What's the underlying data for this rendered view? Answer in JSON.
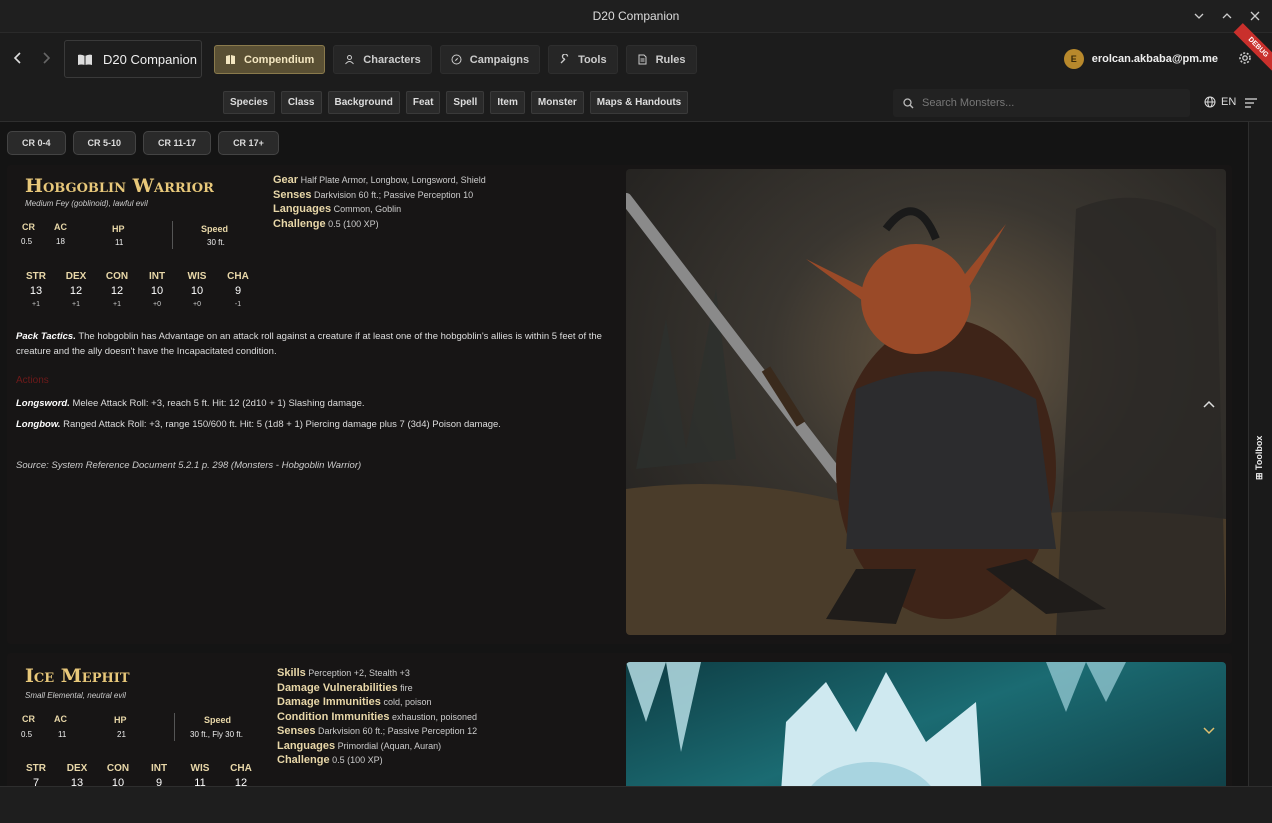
{
  "window": {
    "title": "D20 Companion"
  },
  "brand": {
    "name": "D20 Companion"
  },
  "main_tabs": [
    {
      "label": "Compendium"
    },
    {
      "label": "Characters"
    },
    {
      "label": "Campaigns"
    },
    {
      "label": "Tools"
    },
    {
      "label": "Rules"
    }
  ],
  "user": {
    "initial": "E",
    "email": "erolcan.akbaba@pm.me"
  },
  "debug_label": "DEBUG",
  "categories": [
    "Species",
    "Class",
    "Background",
    "Feat",
    "Spell",
    "Item",
    "Monster",
    "Maps & Handouts"
  ],
  "search": {
    "placeholder": "Search Monsters..."
  },
  "language": "EN",
  "cr_filters": [
    "CR 0-4",
    "CR 5-10",
    "CR 11-17",
    "CR 17+"
  ],
  "toolbox_label": "Toolbox",
  "monsters": [
    {
      "name": "Hobgoblin Warrior",
      "type": "Medium Fey (goblinoid), lawful evil",
      "cr_label": "CR",
      "cr": "0.5",
      "ac_label": "AC",
      "ac": "18",
      "hp_label": "HP",
      "hp": "11",
      "speed_label": "Speed",
      "speed": "30 ft.",
      "abilities": [
        {
          "name": "STR",
          "score": "13",
          "mod": "+1"
        },
        {
          "name": "DEX",
          "score": "12",
          "mod": "+1"
        },
        {
          "name": "CON",
          "score": "12",
          "mod": "+1"
        },
        {
          "name": "INT",
          "score": "10",
          "mod": "+0"
        },
        {
          "name": "WIS",
          "score": "10",
          "mod": "+0"
        },
        {
          "name": "CHA",
          "score": "9",
          "mod": "-1"
        }
      ],
      "props": [
        {
          "k": "Gear",
          "v": "Half Plate Armor, Longbow, Longsword, Shield"
        },
        {
          "k": "Senses",
          "v": "Darkvision 60 ft.; Passive Perception 10"
        },
        {
          "k": "Languages",
          "v": "Common, Goblin"
        },
        {
          "k": "Challenge",
          "v": "0.5 (100 XP)"
        }
      ],
      "trait_name": "Pack Tactics.",
      "trait_text": "The hobgoblin has Advantage on an attack roll against a creature if at least one of the hobgoblin's allies is within 5 feet of the creature and the ally doesn't have the Incapacitated condition.",
      "actions_heading": "Actions",
      "action1_name": "Longsword.",
      "action1_text": "Melee Attack Roll: +3, reach 5 ft. Hit: 12 (2d10 + 1) Slashing damage.",
      "action2_name": "Longbow.",
      "action2_text": "Ranged Attack Roll: +3, range 150/600 ft. Hit: 5 (1d8 + 1) Piercing damage plus 7 (3d4) Poison damage.",
      "source": "Source: System Reference Document 5.2.1 p. 298 (Monsters - Hobgoblin Warrior)"
    },
    {
      "name": "Ice Mephit",
      "type": "Small Elemental, neutral evil",
      "cr_label": "CR",
      "cr": "0.5",
      "ac_label": "AC",
      "ac": "11",
      "hp_label": "HP",
      "hp": "21",
      "speed_label": "Speed",
      "speed": "30 ft., Fly 30 ft.",
      "abilities": [
        {
          "name": "STR",
          "score": "7"
        },
        {
          "name": "DEX",
          "score": "13"
        },
        {
          "name": "CON",
          "score": "10"
        },
        {
          "name": "INT",
          "score": "9"
        },
        {
          "name": "WIS",
          "score": "11"
        },
        {
          "name": "CHA",
          "score": "12"
        }
      ],
      "props": [
        {
          "k": "Skills",
          "v": "Perception +2, Stealth +3"
        },
        {
          "k": "Damage Vulnerabilities",
          "v": "fire"
        },
        {
          "k": "Damage Immunities",
          "v": "cold, poison"
        },
        {
          "k": "Condition Immunities",
          "v": "exhaustion, poisoned"
        },
        {
          "k": "Senses",
          "v": "Darkvision 60 ft.; Passive Perception 12"
        },
        {
          "k": "Languages",
          "v": "Primordial (Aquan, Auran)"
        },
        {
          "k": "Challenge",
          "v": "0.5 (100 XP)"
        }
      ]
    }
  ]
}
